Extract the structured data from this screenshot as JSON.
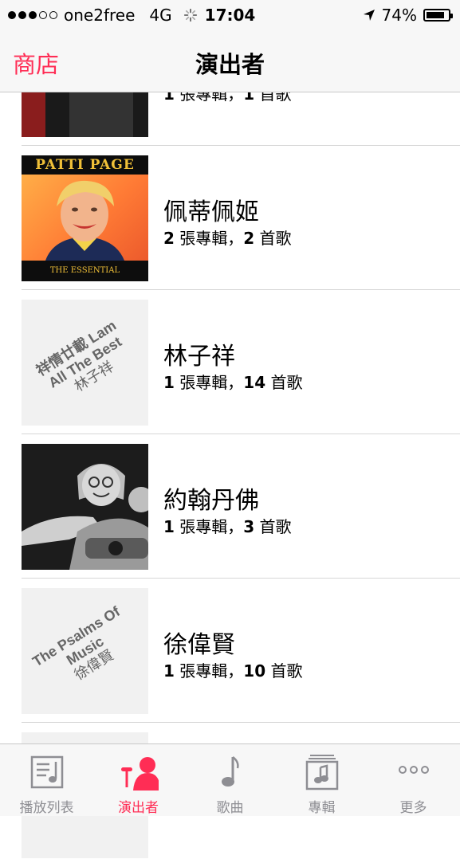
{
  "status": {
    "carrier": "one2free",
    "network": "4G",
    "time": "17:04",
    "battery": "74%"
  },
  "nav": {
    "back_label": "商店",
    "title": "演出者"
  },
  "list": [
    {
      "name": "",
      "meta_prefix": "1",
      "meta_mid": " 張專輯，",
      "meta_num2": "1",
      "meta_suffix": " 首歌",
      "art": "partial-album-cover"
    },
    {
      "name": "佩蒂佩姬",
      "meta_prefix": "2",
      "meta_mid": " 張專輯，",
      "meta_num2": "2",
      "meta_suffix": " 首歌",
      "art": "patti-page-album",
      "art_top": "PATTI PAGE",
      "art_bottom": "THE ESSENTIAL COLLECTION"
    },
    {
      "name": "林子祥",
      "meta_prefix": "1",
      "meta_mid": " 張專輯，",
      "meta_num2": "14",
      "meta_suffix": " 首歌",
      "art": "placeholder",
      "art_lines": [
        "祥情廿載 Lam",
        "All The Best",
        "林子祥"
      ]
    },
    {
      "name": "約翰丹佛",
      "meta_prefix": "1",
      "meta_mid": " 張專輯，",
      "meta_num2": "3",
      "meta_suffix": " 首歌",
      "art": "john-denver-photo"
    },
    {
      "name": "徐偉賢",
      "meta_prefix": "1",
      "meta_mid": " 張專輯，",
      "meta_num2": "10",
      "meta_suffix": " 首歌",
      "art": "placeholder",
      "art_lines": [
        "The Psalms Of",
        "Music",
        "徐偉賢"
      ]
    }
  ],
  "tabs": [
    {
      "label": "播放列表",
      "icon": "playlist-icon",
      "active": false
    },
    {
      "label": "演出者",
      "icon": "artist-icon",
      "active": true
    },
    {
      "label": "歌曲",
      "icon": "music-note-icon",
      "active": false
    },
    {
      "label": "專輯",
      "icon": "album-icon",
      "active": false
    },
    {
      "label": "更多",
      "icon": "more-icon",
      "active": false
    }
  ],
  "colors": {
    "accent": "#ff2d55",
    "inactive": "#8e8e93"
  }
}
